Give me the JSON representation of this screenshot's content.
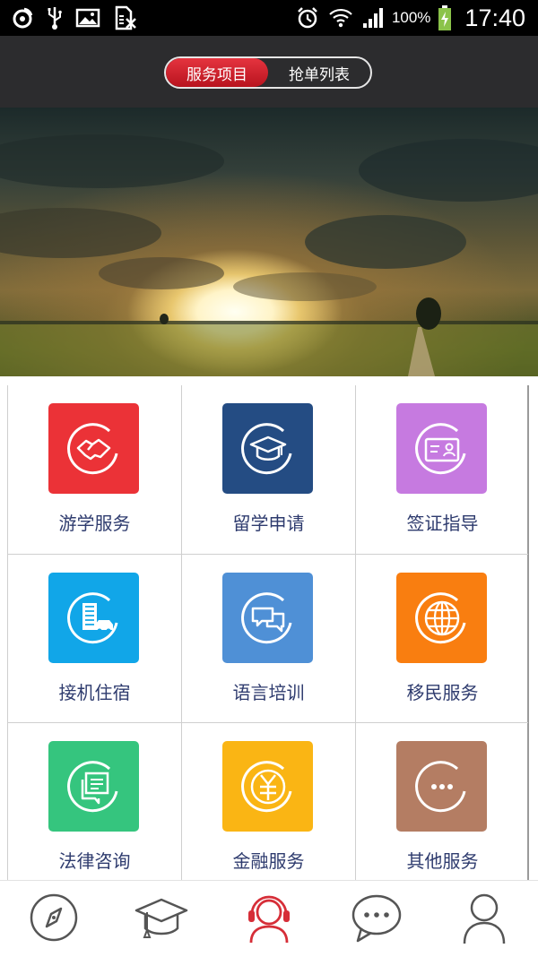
{
  "status_bar": {
    "battery_percent": "100%",
    "time": "17:40",
    "icons": [
      "weibo-icon",
      "usb-icon",
      "image-icon",
      "sim-icon",
      "alarm-icon",
      "wifi-icon",
      "signal-icon",
      "battery-charging-icon"
    ]
  },
  "header": {
    "tabs": [
      {
        "label": "服务项目",
        "active": true
      },
      {
        "label": "抢单列表",
        "active": false
      }
    ]
  },
  "banner": {
    "description_icon": "sunset-landscape-image"
  },
  "services": [
    {
      "label": "游学服务",
      "icon": "handshake-icon",
      "color": "#eb3237"
    },
    {
      "label": "留学申请",
      "icon": "graduation-cap-icon",
      "color": "#244c83"
    },
    {
      "label": "签证指导",
      "icon": "id-card-icon",
      "color": "#c67ae0"
    },
    {
      "label": "接机住宿",
      "icon": "building-car-icon",
      "color": "#11a6e8"
    },
    {
      "label": "语言培训",
      "icon": "chat-bubbles-icon",
      "color": "#4f90d6"
    },
    {
      "label": "移民服务",
      "icon": "globe-icon",
      "color": "#f97e10"
    },
    {
      "label": "法律咨询",
      "icon": "legal-document-icon",
      "color": "#35c57e"
    },
    {
      "label": "金融服务",
      "icon": "yuan-coin-icon",
      "color": "#fab514"
    },
    {
      "label": "其他服务",
      "icon": "more-dots-icon",
      "color": "#b47d63"
    }
  ],
  "bottom_nav": [
    {
      "icon": "compass-icon",
      "active": false
    },
    {
      "icon": "graduation-cap-icon",
      "active": false
    },
    {
      "icon": "customer-service-icon",
      "active": true
    },
    {
      "icon": "message-icon",
      "active": false
    },
    {
      "icon": "profile-icon",
      "active": false
    }
  ],
  "colors": {
    "accent": "#d62e38",
    "header_bg": "#2c2c2e",
    "label_text": "#2e3b6e",
    "nav_inactive": "#555555"
  }
}
